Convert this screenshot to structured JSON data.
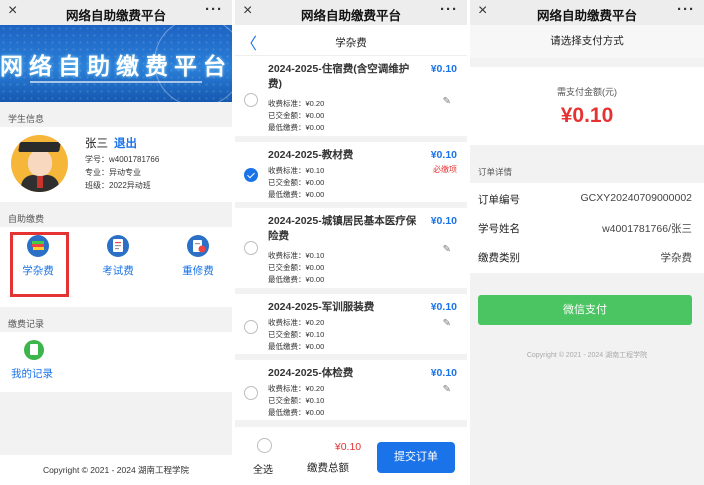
{
  "common": {
    "platform_title": "网络自助缴费平台",
    "close": "×",
    "more": "···"
  },
  "panel1": {
    "banner_text": "网络自助缴费平台",
    "student_section": "学生信息",
    "student": {
      "name": "张三",
      "logout": "退出",
      "id": "学号：w4001781766",
      "major": "专业：异动专业",
      "class": "班级：2022异动班"
    },
    "pay_section": "自助缴费",
    "pay_items": [
      {
        "label": "学杂费",
        "icon": "books-icon",
        "color": "#2b7bd6"
      },
      {
        "label": "考试费",
        "icon": "exam-icon",
        "color": "#2b7bd6"
      },
      {
        "label": "重修费",
        "icon": "retake-icon",
        "color": "#2b7bd6"
      }
    ],
    "record_section": "缴费记录",
    "record_label": "我的记录",
    "footer": "Copyright © 2021 - 2024 湖南工程学院"
  },
  "panel2": {
    "back": "〈",
    "subtitle": "学杂费",
    "fees": [
      {
        "name": "2024-2025-住宿费(含空调维护费)",
        "price": "¥0.10",
        "std": "收费标准：¥0.20",
        "paid": "已交金额：¥0.00",
        "min": "最低缴费：¥0.00",
        "required": "",
        "checked": false
      },
      {
        "name": "2024-2025-教材费",
        "price": "¥0.10",
        "std": "收费标准：¥0.10",
        "paid": "已交金额：¥0.00",
        "min": "最低缴费：¥0.00",
        "required": "必缴项",
        "checked": true
      },
      {
        "name": "2024-2025-城镇居民基本医疗保险费",
        "price": "¥0.10",
        "std": "收费标准：¥0.10",
        "paid": "已交金额：¥0.00",
        "min": "最低缴费：¥0.00",
        "required": "",
        "checked": false
      },
      {
        "name": "2024-2025-军训服装费",
        "price": "¥0.10",
        "std": "收费标准：¥0.20",
        "paid": "已交金额：¥0.10",
        "min": "最低缴费：¥0.00",
        "required": "",
        "checked": false
      },
      {
        "name": "2024-2025-体检费",
        "price": "¥0.10",
        "std": "收费标准：¥0.20",
        "paid": "已交金额：¥0.10",
        "min": "最低缴费：¥0.00",
        "required": "",
        "checked": false
      }
    ],
    "select_all": "全选",
    "total_amount": "¥0.10",
    "total_label": "缴费总额",
    "submit": "提交订单"
  },
  "panel3": {
    "subtitle": "请选择支付方式",
    "amount_label": "需支付金额(元)",
    "amount": "¥0.10",
    "detail_title": "订单详情",
    "details": [
      {
        "k": "订单编号",
        "v": "GCXY20240709000002"
      },
      {
        "k": "学号姓名",
        "v": "w4001781766/张三"
      },
      {
        "k": "缴费类别",
        "v": "学杂费"
      }
    ],
    "pay_button": "微信支付",
    "copyright": "Copyright © 2021 - 2024 湖南工程学院"
  }
}
